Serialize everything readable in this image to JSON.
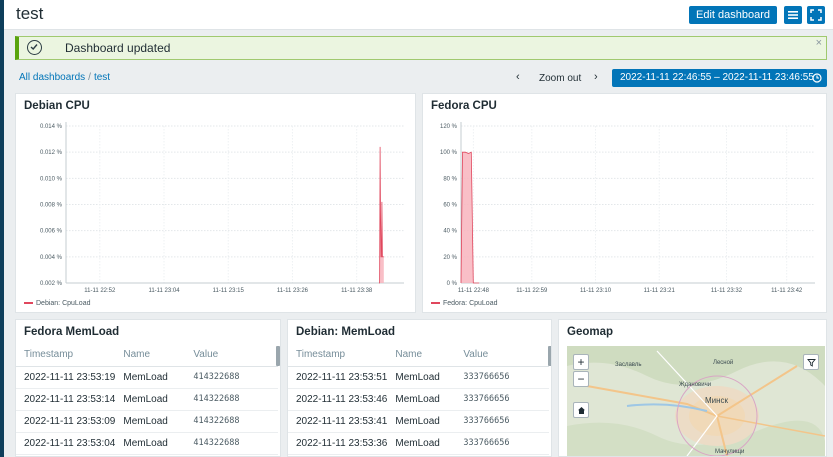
{
  "header": {
    "title": "test",
    "edit_label": "Edit dashboard"
  },
  "message": {
    "text": "Dashboard updated",
    "close": "×"
  },
  "breadcrumb": {
    "root": "All dashboards",
    "separator": "/",
    "current": "test"
  },
  "timebar": {
    "prev": "‹",
    "zoom_out": "Zoom out",
    "next": "›",
    "range": "2022-11-11 22:46:55 – 2022-11-11 23:46:55"
  },
  "widgets": {
    "debian_cpu": {
      "title": "Debian CPU",
      "legend": "Debian: CpuLoad"
    },
    "fedora_cpu": {
      "title": "Fedora CPU",
      "legend": "Fedora: CpuLoad"
    },
    "fedora_mem": {
      "title": "Fedora MemLoad",
      "columns": [
        "Timestamp",
        "Name",
        "Value"
      ],
      "rows": [
        [
          "2022-11-11 23:53:19",
          "MemLoad",
          "414322688"
        ],
        [
          "2022-11-11 23:53:14",
          "MemLoad",
          "414322688"
        ],
        [
          "2022-11-11 23:53:09",
          "MemLoad",
          "414322688"
        ],
        [
          "2022-11-11 23:53:04",
          "MemLoad",
          "414322688"
        ]
      ]
    },
    "debian_mem": {
      "title": "Debian: MemLoad",
      "columns": [
        "Timestamp",
        "Name",
        "Value"
      ],
      "rows": [
        [
          "2022-11-11 23:53:51",
          "MemLoad",
          "333766656"
        ],
        [
          "2022-11-11 23:53:46",
          "MemLoad",
          "333766656"
        ],
        [
          "2022-11-11 23:53:41",
          "MemLoad",
          "333766656"
        ],
        [
          "2022-11-11 23:53:36",
          "MemLoad",
          "333766656"
        ]
      ]
    },
    "geomap": {
      "title": "Geomap",
      "zoom_in": "+",
      "zoom_out": "−",
      "labels": [
        "Заславль",
        "Лесной",
        "Ждановичи",
        "Минск",
        "Мачулищи"
      ]
    }
  },
  "colors": {
    "accent": "#0275b8",
    "series": "#e0475d",
    "series_fill": "#f8b4bd",
    "success": "#59a30e"
  },
  "chart_data": [
    {
      "type": "area",
      "title": "Debian CPU",
      "series": [
        {
          "name": "Debian: CpuLoad",
          "x": [
            "23:42:30",
            "23:42:35",
            "23:42:40",
            "23:42:45",
            "23:42:50",
            "23:42:55",
            "23:43:00",
            "23:43:05",
            "23:43:10",
            "23:43:20"
          ],
          "values": [
            0.002,
            0.002,
            0.0124,
            0.0075,
            0.004,
            0.004,
            0.0082,
            0.004,
            0.004,
            0.004
          ]
        }
      ],
      "yticks": [
        "0.014 %",
        "0.012 %",
        "0.010 %",
        "0.008 %",
        "0.006 %",
        "0.004 %",
        "0.002 %"
      ],
      "ylim": [
        0.002,
        0.014
      ],
      "xticks": [
        "11-11 22:52",
        "11-11 23:04",
        "11-11 23:15",
        "11-11 23:26",
        "11-11 23:38"
      ]
    },
    {
      "type": "area",
      "title": "Fedora CPU",
      "series": [
        {
          "name": "Fedora: CpuLoad",
          "x": [
            "22:46:55",
            "22:47:10",
            "22:47:40",
            "22:48:10",
            "22:48:40",
            "22:49:00",
            "22:50:00"
          ],
          "values": [
            0,
            100,
            100,
            99,
            100,
            0,
            0
          ]
        }
      ],
      "yticks": [
        "120 %",
        "100 %",
        "80 %",
        "60 %",
        "40 %",
        "20 %",
        "0 %"
      ],
      "ylim": [
        0,
        120
      ],
      "xticks": [
        "11-11 22:48",
        "11-11 22:59",
        "11-11 23:10",
        "11-11 23:21",
        "11-11 23:32",
        "11-11 23:42"
      ]
    }
  ]
}
